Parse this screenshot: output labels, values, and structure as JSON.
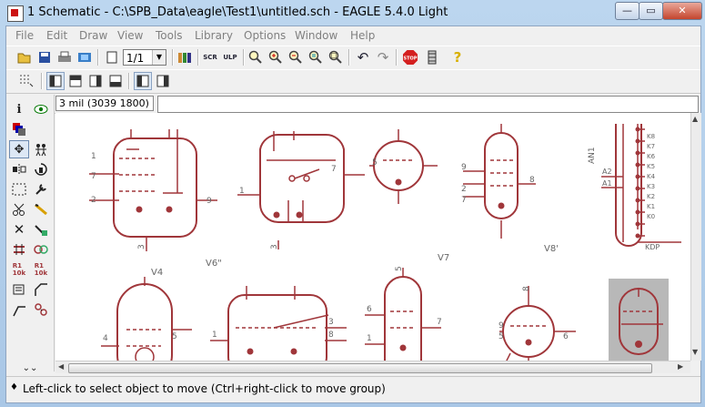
{
  "window": {
    "title": "1 Schematic - C:\\SPB_Data\\eagle\\Test1\\untitled.sch - EAGLE 5.4.0 Light",
    "minimize_glyph": "—",
    "maximize_glyph": "▭",
    "close_glyph": "✕"
  },
  "menu": [
    "File",
    "Edit",
    "Draw",
    "View",
    "Tools",
    "Library",
    "Options",
    "Window",
    "Help"
  ],
  "toolbar": {
    "sheet_select": "1/1",
    "icons": [
      "open-icon",
      "save-icon",
      "print-icon",
      "cam-icon",
      "sheet-select",
      "use-library-icon",
      "script-icon",
      "ulp-icon",
      "zoom-fit-icon",
      "zoom-in-icon",
      "zoom-out-icon",
      "zoom-redraw-icon",
      "zoom-select-icon",
      "undo-icon",
      "redo-icon",
      "stop-icon",
      "go-icon",
      "help-icon"
    ],
    "stop_label": "STOP",
    "help_glyph": "?"
  },
  "coords": "3 mil (3039 1800)",
  "status": "Left-click to select object to move (Ctrl+right-click to move group)",
  "schematic": {
    "color": "#a0363a",
    "labels": {
      "v4": "V4",
      "v6": "V6\"",
      "v7": "V7",
      "v8": "V8'",
      "an1": "AN1",
      "a1": "A1",
      "a2": "A2",
      "kdp": "KDP"
    },
    "pins": {
      "p1": "1",
      "p2": "2",
      "p3": "3",
      "p4": "4",
      "p5": "5",
      "p6": "6",
      "p7": "7",
      "p8": "8",
      "p9": "9"
    },
    "k_pins": [
      "K8",
      "K7",
      "K6",
      "K5",
      "K4",
      "K3",
      "K2",
      "K1",
      "K0"
    ]
  },
  "palette_icons": [
    "info-icon",
    "eye-icon",
    "display-icon",
    "move-icon",
    "mirror-icon",
    "copy-icon",
    "rotate-icon",
    "group-icon",
    "change-icon",
    "cut-icon",
    "paste-icon",
    "delete-icon",
    "add-icon",
    "pinswap-icon",
    "gateswap-icon",
    "replace-icon",
    "name-icon",
    "value-icon",
    "split-icon",
    "miter-icon",
    "wire-icon",
    "invoke-icon",
    "more-icon"
  ],
  "status_glyph": "♦"
}
